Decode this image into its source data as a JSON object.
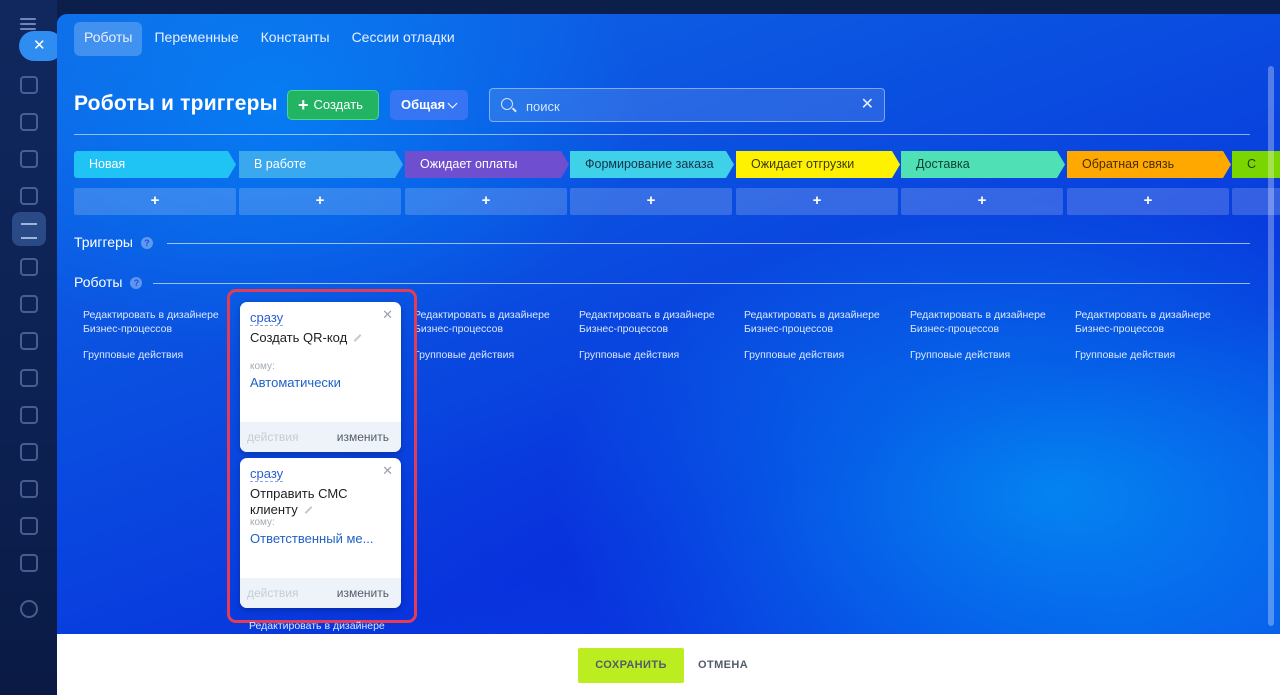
{
  "tabs": [
    {
      "label": "Роботы",
      "active": true
    },
    {
      "label": "Переменные",
      "active": false
    },
    {
      "label": "Константы",
      "active": false
    },
    {
      "label": "Сессии отладки",
      "active": false
    }
  ],
  "title": "Роботы и триггеры",
  "create_label": "Создать",
  "general_label": "Общая",
  "search": {
    "placeholder": "поиск",
    "value": ""
  },
  "stages": [
    {
      "label": "Новая",
      "color": "#20c4f4"
    },
    {
      "label": "В работе",
      "color": "#39a8ef"
    },
    {
      "label": "Ожидает оплаты",
      "color": "#6f4fd0"
    },
    {
      "label": "Формирование заказа",
      "color": "#3fd1e8"
    },
    {
      "label": "Ожидает отгрузки",
      "color": "#fff200"
    },
    {
      "label": "Доставка",
      "color": "#4fe0b5"
    },
    {
      "label": "Обратная связь",
      "color": "#ffa900"
    },
    {
      "label": "С",
      "color": "#7bd500"
    }
  ],
  "add_label": "+",
  "sections": {
    "triggers": "Триггеры",
    "robots": "Роботы",
    "help": "?"
  },
  "column_links": {
    "edit": "Редактировать в дизайнере Бизнес-процессов",
    "group": "Групповые действия",
    "edit_short": "Редактировать в дизайнере"
  },
  "robots": [
    {
      "when": "сразу",
      "name": "Создать QR-код",
      "to_label": "кому:",
      "to": "Автоматически",
      "actions": "действия",
      "change": "изменить"
    },
    {
      "when": "сразу",
      "name": "Отправить СМС клиенту",
      "to_label": "кому:",
      "to": "Ответственный ме...",
      "actions": "действия",
      "change": "изменить"
    }
  ],
  "footer": {
    "save": "СОХРАНИТЬ",
    "cancel": "ОТМЕНА"
  }
}
